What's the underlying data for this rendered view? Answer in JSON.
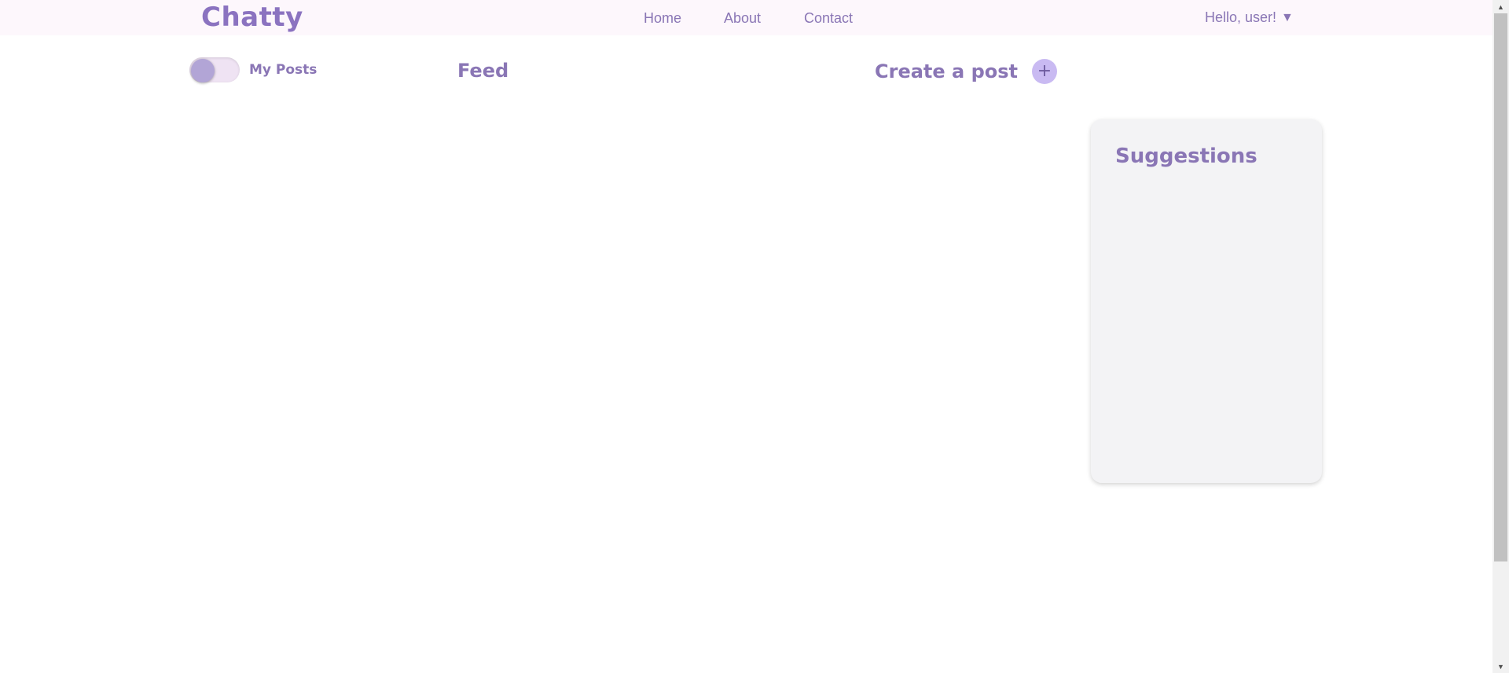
{
  "navbar": {
    "logo_text": "Chatty",
    "links": [
      {
        "label": "Home"
      },
      {
        "label": "About"
      },
      {
        "label": "Contact"
      }
    ],
    "greeting": "Hello, user!",
    "greeting_caret": "▼"
  },
  "feed": {
    "toggle_label": "My Posts",
    "toggle_on": false,
    "title": "Feed",
    "create_label": "Create a post",
    "create_icon": "+"
  },
  "sidebar": {
    "title": "Suggestions"
  },
  "scrollbar": {
    "up_arrow": "▲",
    "down_arrow": "▼"
  },
  "colors": {
    "brand": "#8a76b5",
    "navbar_bg": "#fdf7fc",
    "toggle_knob": "#b2a5d6",
    "plus_bg": "#c9baf2",
    "card_bg": "#f3f3f5"
  }
}
